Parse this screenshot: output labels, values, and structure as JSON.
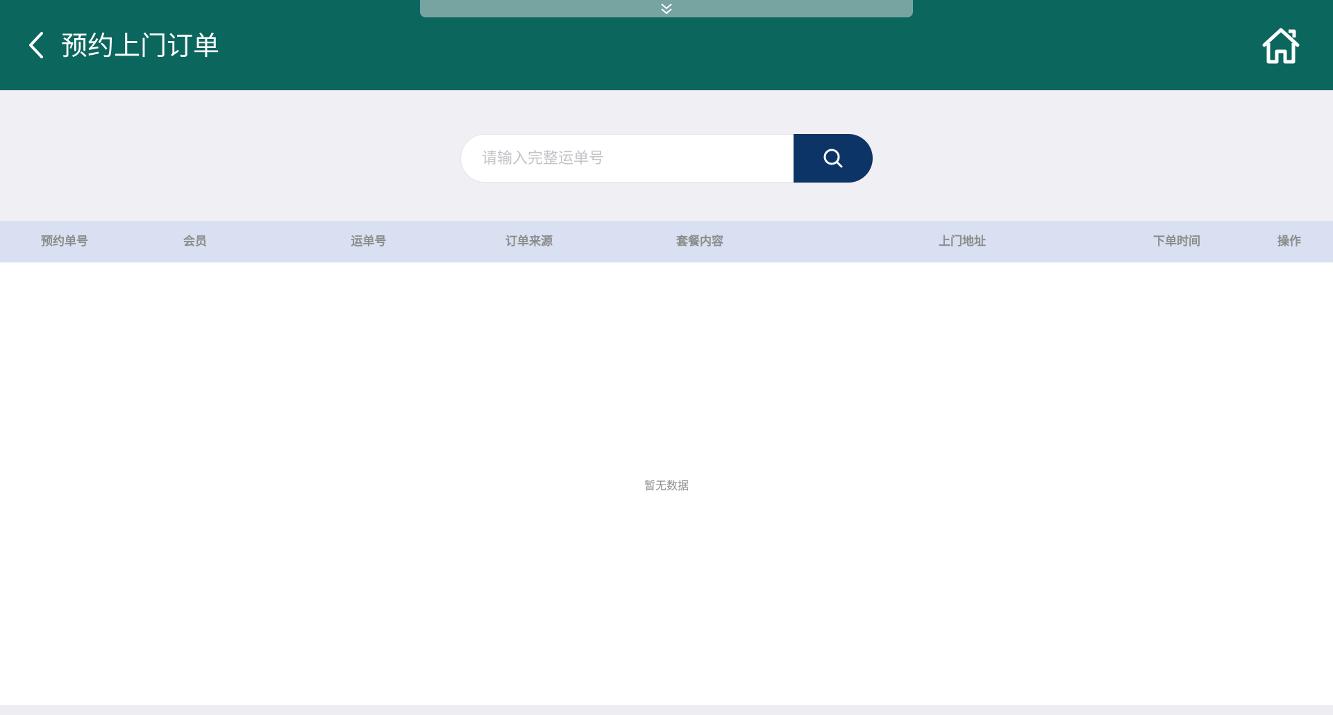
{
  "header": {
    "title": "预约上门订单",
    "back_icon": "chevron-left-icon",
    "home_icon": "home-icon",
    "pull_tab_icon": "double-chevron-down-icon",
    "background_color": "#0b665e"
  },
  "search": {
    "placeholder": "请输入完整运单号",
    "value": "",
    "button_icon": "search-icon",
    "button_color": "#0d3466"
  },
  "table": {
    "columns": [
      "预约单号",
      "会员",
      "运单号",
      "订单来源",
      "套餐内容",
      "上门地址",
      "下单时间",
      "操作"
    ],
    "rows": [],
    "empty_text": "暂无数据",
    "header_color": "#d8e0f1"
  }
}
